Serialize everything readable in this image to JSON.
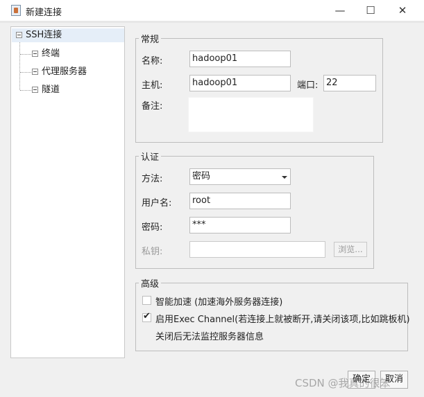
{
  "window": {
    "title": "新建连接",
    "minimize": "—",
    "maximize": "☐",
    "close": "✕"
  },
  "tree": {
    "root": "SSH连接",
    "children": [
      "终端",
      "代理服务器",
      "隧道"
    ]
  },
  "general": {
    "legend": "常规",
    "name_label": "名称:",
    "name_value": "hadoop01",
    "host_label": "主机:",
    "host_value": "hadoop01",
    "port_label": "端口:",
    "port_value": "22",
    "notes_label": "备注:",
    "notes_value": ""
  },
  "auth": {
    "legend": "认证",
    "method_label": "方法:",
    "method_value": "密码",
    "user_label": "用户名:",
    "user_value": "root",
    "password_label": "密码:",
    "password_value": "***",
    "key_label": "私钥:",
    "key_value": "",
    "browse_label": "浏览..."
  },
  "advanced": {
    "legend": "高级",
    "smart_accel_label": "智能加速 (加速海外服务器连接)",
    "smart_accel_checked": false,
    "exec_channel_label": "启用Exec Channel(若连接上就被断开,请关闭该项,比如跳板机)",
    "exec_channel_checked": true,
    "exec_channel_note": "关闭后无法监控服务器信息"
  },
  "footer": {
    "ok_label": "确定",
    "cancel_label": "取消"
  },
  "watermark": "CSDN @我真的很笨"
}
